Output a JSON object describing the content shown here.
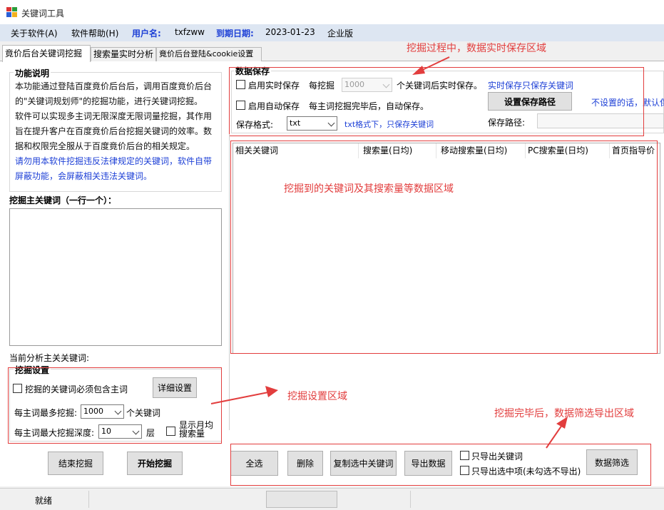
{
  "window": {
    "title": "关键词工具"
  },
  "menu": {
    "about": "关于软件(A)",
    "help": "软件帮助(H)",
    "user_label": "用户名:",
    "user_value": "txfzww",
    "expire_label": "到期日期:",
    "expire_value": "2023-01-23",
    "edition": "企业版"
  },
  "tabs": [
    {
      "label": "竟价后台关键词挖掘"
    },
    {
      "label": "搜索量实时分析"
    },
    {
      "label": "竟价后台登陆&cookie设置"
    }
  ],
  "description": {
    "title": "功能说明",
    "paragraph1": "本功能通过登陆百度竟价后台后，调用百度竟价后台的\"关键词规划师\"的挖掘功能，进行关键词挖掘。",
    "paragraph2": "软件可以实现多主词无限深度无限词量挖掘，其作用旨在提升客户在百度竟价后台挖掘关键词的效率。数据和权限完全服从于百度竟价后台的相关规定。",
    "warning": "请勿用本软件挖掘违反法律规定的关键词，软件自带屏蔽功能，会屏蔽相关违法关键词。"
  },
  "main_keywords": {
    "label": "挖掘主关键词（一行一个）：",
    "value": "",
    "current_label": "当前分析主关关键词:"
  },
  "mining_settings": {
    "title": "挖掘设置",
    "must_contain_label": "挖掘的关键词必须包含主词",
    "detail_button": "详细设置",
    "max_mine_label": "每主词最多挖掘:",
    "max_mine_value": "1000",
    "max_mine_unit": "个关键词",
    "max_depth_label": "每主词最大挖掘深度:",
    "max_depth_value": "10",
    "max_depth_unit": "层",
    "show_monthly_label_1": "显示月均",
    "show_monthly_label_2": "搜索量"
  },
  "actions": {
    "stop": "结束挖掘",
    "start": "开始挖掘"
  },
  "data_save": {
    "title": "数据保存",
    "realtime_label": "启用实时保存",
    "every_label": "每挖掘",
    "every_value": "1000",
    "every_suffix": "个关键词后实时保存。",
    "realtime_note": "实时保存只保存关键词",
    "path_button": "设置保存路径",
    "path_note": "不设置的话，默认保",
    "auto_label": "启用自动保存",
    "auto_note": "每主词挖掘完毕后，自动保存。",
    "format_label": "保存格式:",
    "format_value": "txt",
    "format_note": "txt格式下，只保存关键词",
    "path_label": "保存路径:",
    "path_value": ""
  },
  "table": {
    "columns": [
      "相关关键词",
      "搜索量(日均)",
      "移动搜索量(日均)",
      "PC搜索量(日均)",
      "首页指导价"
    ],
    "rows": []
  },
  "bottom": {
    "select_all": "全选",
    "delete": "删除",
    "copy_selected": "复制选中关键词",
    "export": "导出数据",
    "only_keywords": "只导出关键词",
    "only_selected": "只导出选中项(未勾选不导出)",
    "filter": "数据筛选"
  },
  "status": {
    "text": "就绪"
  },
  "annotations": {
    "save_area": "挖掘过程中，数据实时保存区域",
    "data_area": "挖掘到的关键词及其搜索量等数据区域",
    "settings_area": "挖掘设置区域",
    "export_area": "挖掘完毕后，数据筛选导出区域"
  },
  "colors": {
    "annotation_red": "#e23d3d",
    "link_blue": "#1c3fd6",
    "menu_bg": "#dde6f2"
  }
}
